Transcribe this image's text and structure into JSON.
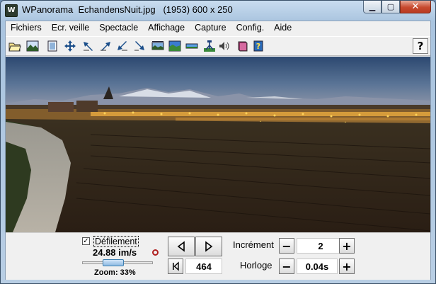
{
  "window": {
    "app_name": "WPanorama",
    "file_name": "EchandensNuit.jpg",
    "file_info": "(1953) 600 x 250"
  },
  "menu": [
    "Fichiers",
    "Ecr. veille",
    "Spectacle",
    "Affichage",
    "Capture",
    "Config.",
    "Aide"
  ],
  "toolbar_icons": [
    "open-file-icon",
    "picture-icon",
    "fit-screen-icon",
    "move-arrows-icon",
    "scroll-left-up-icon",
    "scroll-right-up-icon",
    "scroll-left-down-icon",
    "scroll-right-down-icon",
    "panorama-icon",
    "tile-view-icon",
    "flat-view-icon",
    "tripod-icon",
    "speaker-icon",
    "book-icon",
    "help-topics-icon",
    "help-question-icon"
  ],
  "help_button_label": "?",
  "controls": {
    "scroll_label": "Défilement",
    "scroll_checked": true,
    "speed": "24.88 im/s",
    "zoom": "Zoom: 33%",
    "zoom_fraction": 0.33,
    "position": "464",
    "increment_label": "Incrément",
    "increment_value": "2",
    "clock_label": "Horloge",
    "clock_value": "0.04s",
    "minus": "−",
    "plus": "+"
  },
  "colors": {
    "title_bar": "#b8cee4",
    "window_bg": "#f0f0f0",
    "close_button": "#c7492e",
    "slider_thumb": "#8fbbe3"
  }
}
